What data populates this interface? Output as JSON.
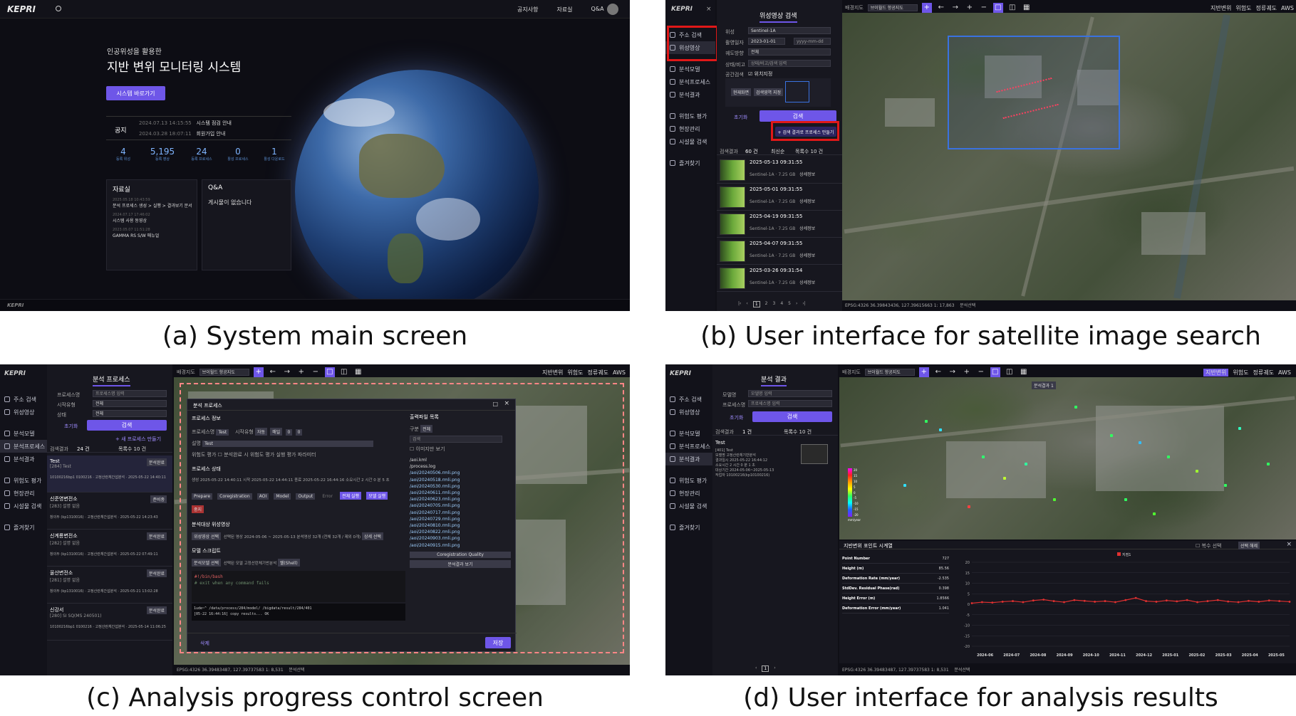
{
  "captions": {
    "a": "(a) System main screen",
    "b": "(b) User interface for satellite image search",
    "c": "(c) Analysis progress control screen",
    "d": "(d) User interface for analysis results"
  },
  "a": {
    "logo": "KEPRI",
    "nav": [
      "공지사항",
      "자료실",
      "Q&A"
    ],
    "hero_sub": "인공위성을 활용한",
    "hero_title": "지반 변위 모니터링 시스템",
    "cta": "시스템 바로가기",
    "notice_label": "공지",
    "notices": [
      {
        "date": "2024.07.13 14:15:55",
        "title": "시스템 점검 안내"
      },
      {
        "date": "2024.03.28 18:07:11",
        "title": "회원가입 안내"
      }
    ],
    "stats": [
      {
        "v": "4",
        "l": "등록 위성"
      },
      {
        "v": "5,195",
        "l": "등록 영상"
      },
      {
        "v": "24",
        "l": "등록 프로세스"
      },
      {
        "v": "0",
        "l": "활성 프로세스"
      },
      {
        "v": "1",
        "l": "활성 다운로드"
      }
    ],
    "archive_title": "자료실",
    "archive": [
      {
        "date": "2025.05.18 10:43:59",
        "title": "분석 프로세스 생성 > 실행 > 결과보기 문서"
      },
      {
        "date": "2024.07.17 17:46:02",
        "title": "시스템 사용 동영상"
      },
      {
        "date": "2023.05.07 11:51:28",
        "title": "GAMMA RS S/W 매뉴얼"
      }
    ],
    "qa_title": "Q&A",
    "qa_empty": "게시물이 없습니다",
    "footer": "KEPRI"
  },
  "b": {
    "logo": "KEPRI",
    "sidebar": [
      "주소 검색",
      "위성영상",
      "분석모델",
      "분석프로세스",
      "분석결과",
      "위험도 평가",
      "현장관리",
      "시설물 검색",
      "즐겨찾기"
    ],
    "panel_title": "위성영상 검색",
    "labels": [
      "위성",
      "촬영일자",
      "궤도방향",
      "상태/비고",
      "공간검색"
    ],
    "satellite": "Sentinel-1A",
    "date_from": "2023-01-01",
    "date_to": "yyyy-mm-dd",
    "orbit": "전체",
    "status_ph": "상태/비고/검색 입력",
    "spatial_chk": "위치지정",
    "btn_cur": "현재화면",
    "btn_area": "검색영역 지정",
    "reset": "초기화",
    "search": "검색",
    "make_proc": "+ 검색 결과로 프로세스 만들기",
    "result_label": "검색결과",
    "result_count": "60 건",
    "sort": "최신순",
    "per_page": "목록수 10 건",
    "results": [
      {
        "date": "2025-05-13 09:31:55",
        "sat": "Sentinel-1A",
        "size": "7.25 GB",
        "more": "상세정보"
      },
      {
        "date": "2025-05-01 09:31:55",
        "sat": "Sentinel-1A",
        "size": "7.25 GB",
        "more": "상세정보"
      },
      {
        "date": "2025-04-19 09:31:55",
        "sat": "Sentinel-1A",
        "size": "7.25 GB",
        "more": "상세정보"
      },
      {
        "date": "2025-04-07 09:31:55",
        "sat": "Sentinel-1A",
        "size": "7.25 GB",
        "more": "상세정보"
      },
      {
        "date": "2025-03-26 09:31:54",
        "sat": "Sentinel-1A",
        "size": "7.25 GB",
        "more": "상세정보"
      }
    ],
    "pager": [
      "1",
      "2",
      "3",
      "4",
      "5"
    ],
    "basemap_label": "배경지도",
    "basemap": "브이월드 항공지도",
    "tools": [
      "지반변위",
      "위험도",
      "정류궤도",
      "AWS"
    ],
    "coords": "EPSG:4326   36.39843436, 127.39615663   1: 17,863",
    "analysis_sel": "분석선택"
  },
  "c": {
    "panel_title": "분석 프로세스",
    "labels": [
      "프로세스명",
      "시작유형",
      "상태"
    ],
    "proc_ph": "프로세스명 입력",
    "all": "전체",
    "reset": "초기화",
    "search": "검색",
    "new_proc": "+ 새 프로세스 만들기",
    "result_label": "검색결과",
    "result_count": "24 건",
    "per_page": "목록수 10 건",
    "procs": [
      {
        "name": "Test",
        "id": "[284] Test",
        "badge": "분석완료",
        "meta": "10100216bp1 0100216",
        "type": "고정산란체간섭분석",
        "date": "2025-05-22 14:40:11"
      },
      {
        "name": "신준영변전소",
        "id": "[283] 설명 없음",
        "badge": "준비중",
        "meta": "창의두 (kp1310016)",
        "type": "고정산란체간섭분석",
        "date": "2025-05-22 14:23:43"
      },
      {
        "name": "신계룡변전소",
        "id": "[282] 설명 없음",
        "badge": "분석완료",
        "meta": "창의두 (kp1310016)",
        "type": "고정산란체간섭분석",
        "date": "2025-05-22 07:49:11"
      },
      {
        "name": "울산변전소",
        "id": "[281] 설명 없음",
        "badge": "분석완료",
        "meta": "창의두 (kp1310016)",
        "type": "고정산란체간섭분석",
        "date": "2025-05-21 13:02:28"
      },
      {
        "name": "신강서",
        "id": "[280] SI SQ(MS 240501)",
        "badge": "분석완료",
        "meta": "10100216bp1 0100216",
        "type": "고정산란체간섭분석",
        "date": "2025-05-14 11:06:25"
      }
    ],
    "modal": {
      "title": "분석 프로세스",
      "s1": "프로세스 정보",
      "name_label": "프로세스명",
      "name": "Test",
      "start_label": "시작유형",
      "start": "자동",
      "cycle": "매일",
      "hour": "0",
      "min": "0",
      "desc_label": "설명",
      "desc": "Test",
      "risk_label": "위험도 평가",
      "risk_chk": "분석완료 시 위험도 평가 실행",
      "risk_opt": "평가 파라미터",
      "s2": "프로세스 상태",
      "state_label": "생성",
      "created": "2025-05-22 14:40:11",
      "start_t": "시작",
      "start_time": "2025-05-22 14:44:11",
      "end_t": "종료",
      "end_time": "2025-05-22 16:44:16",
      "elapsed_t": "소요시간",
      "elapsed": "2 시간 0 분 5 초",
      "steps": [
        "Prepare",
        "Coregistration",
        "AOI",
        "Model",
        "Output",
        "Error"
      ],
      "run_all": "전체 실행",
      "run_model": "모델 실행",
      "stop": "중지",
      "s3": "분석대상 위성영상",
      "sel_img": "위성영상 선택",
      "sel_period_label": "선택된 영상",
      "period": "2024-05-06 ~ 2025-05-13",
      "count": "분석영상 32개 (전체 32개 / 제외 0개)",
      "detail": "상세 선택",
      "s4": "모델 스크립트",
      "model_sel": "분석모델 선택",
      "model_label": "선택된 모델",
      "model": "고정산란체기반분석",
      "shell": "쉘(Shell)",
      "code": [
        "#!/bin/bash",
        "",
        "# exit when any command fails"
      ],
      "term": [
        "1ude~^ /data/process/284/model/ /bigdata/result/284/401",
        "[05-22 16:44:16] copy results... OK"
      ],
      "out_title": "출력파일 목록",
      "out_kind_label": "구분",
      "out_kind": "전체",
      "out_search": "검색",
      "img_view": "이미지만 보기",
      "files": [
        "/aoi.kml",
        "/process.log",
        "/aoi/20240506.rmli.png",
        "/aoi/20240518.rmli.png",
        "/aoi/20240530.rmli.png",
        "/aoi/20240611.rmli.png",
        "/aoi/20240623.rmli.png",
        "/aoi/20240705.rmli.png",
        "/aoi/20240717.rmli.png",
        "/aoi/20240729.rmli.png",
        "/aoi/20240810.rmli.png",
        "/aoi/20240822.rmli.png",
        "/aoi/20240903.rmli.png",
        "/aoi/20240915.rmli.png"
      ],
      "coreg": "Coregistration Quality",
      "view_result": "분석결과 보기",
      "delete": "삭제",
      "save": "저장"
    },
    "coords": "EPSG:4326   36.39483487, 127.39737583   1: 8,531",
    "analysis_sel": "분석선택"
  },
  "d": {
    "panel_title": "분석 결과",
    "labels": [
      "모델명",
      "프로세스명"
    ],
    "model_ph": "모델명 입력",
    "proc_ph": "프로세스명 입력",
    "reset": "초기화",
    "search": "검색",
    "result_label": "검색결과",
    "result_count": "1 건",
    "per_page": "목록수 10 건",
    "item_title": "Test",
    "item_lines": [
      "[401] Test",
      "모델명  고정산란체기반분석",
      "결과일시  2025-05-22 16:44:12",
      "소요시간  2 시간 0 분 1 초",
      "대상기간  2024-05-06~2025-05-13",
      "작업자  10100216(kp10100216)"
    ],
    "legend": [
      "20",
      "15",
      "10",
      "5",
      "0",
      "-5",
      "-10",
      "-15",
      "-20"
    ],
    "legend_unit": "mm/year",
    "ts_title": "지반변위 포인트 시계열",
    "multi": "복수 선택",
    "sel_clear": "선택 해제",
    "table": [
      {
        "k": "Point Number",
        "v": "727"
      },
      {
        "k": "Height (m)",
        "v": "85.56"
      },
      {
        "k": "Deformation Rate (mm/year)",
        "v": "-2.535"
      },
      {
        "k": "StdDev. Residual Phase(rad)",
        "v": "0.398"
      },
      {
        "k": "Height Error (m)",
        "v": "1.8566"
      },
      {
        "k": "Deformation Error (mm/year)",
        "v": "1.041"
      }
    ],
    "series_name": "지점1",
    "badge": "분석결과 1",
    "coords": "EPSG:4326   36.39483487, 127.39737583   1: 8,531",
    "analysis_sel": "분석선택",
    "chart_data": {
      "type": "line",
      "x": [
        "2024-06",
        "2024-07",
        "2024-08",
        "2024-09",
        "2024-10",
        "2024-11",
        "2024-12",
        "2025-01",
        "2025-02",
        "2025-03",
        "2025-04",
        "2025-05"
      ],
      "yticks": [
        "20",
        "15",
        "10",
        "5",
        "0",
        "-5",
        "-10",
        "-15",
        "-20"
      ],
      "ylim": [
        -20,
        20
      ],
      "series": [
        {
          "name": "지점1",
          "values": [
            0.5,
            1,
            0.8,
            1.2,
            1.5,
            1,
            1.8,
            2.2,
            1.5,
            1,
            2,
            1.6,
            1.2,
            1.5,
            1,
            2,
            3,
            1.5,
            1.2,
            1.8,
            1.4,
            2,
            1,
            1.5,
            2,
            1.3,
            1,
            1.6,
            1.2,
            1.8,
            1.5,
            1.2
          ]
        }
      ]
    }
  }
}
